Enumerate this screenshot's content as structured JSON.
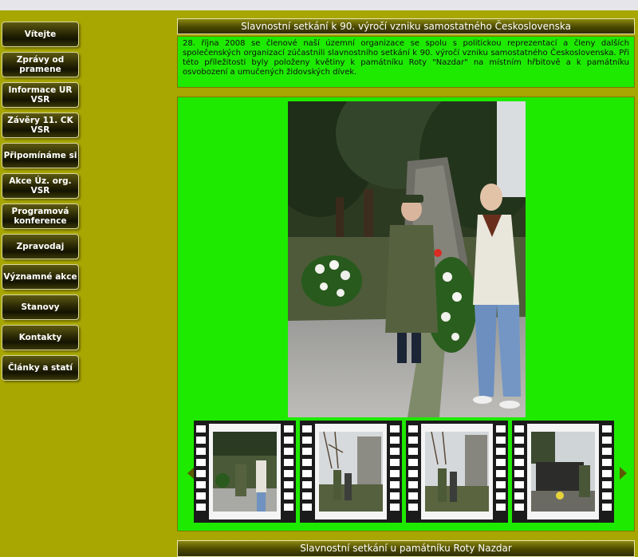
{
  "nav": {
    "items": [
      {
        "label": "Vítejte"
      },
      {
        "label": "Zprávy od pramene"
      },
      {
        "label": "Informace UR VSR"
      },
      {
        "label": "Závěry 11. CK VSR"
      },
      {
        "label": "Připomínáme si"
      },
      {
        "label": "Akce Úz. org. VSR"
      },
      {
        "label": "Programová konference"
      },
      {
        "label": "Zpravodaj"
      },
      {
        "label": "Významné akce"
      },
      {
        "label": "Stanovy"
      },
      {
        "label": "Kontakty"
      },
      {
        "label": "Články a statí"
      }
    ]
  },
  "article": {
    "title": "Slavnostní setkání k 90. výročí vzniku samostatného Československa",
    "body": "28. října 2008 se členové naší územní organizace se spolu s politickou reprezentací a členy dalších společenských organizací zúčastnili slavnostního setkání k 90. výročí vzniku samostatného Československa. Při této příležitosti byly položeny květiny k památníku Roty \"Nazdar\" na místním hřbitově a k památníku osvobození a umučených židovských dívek."
  },
  "gallery": {
    "thumb_count": 4
  },
  "next_article": {
    "title": "Slavnostní setkání u památníku Roty  Nazdar"
  },
  "colors": {
    "page_bg": "#a8a600",
    "panel_green": "#1eea00",
    "nav_dark": "#1a1900"
  }
}
